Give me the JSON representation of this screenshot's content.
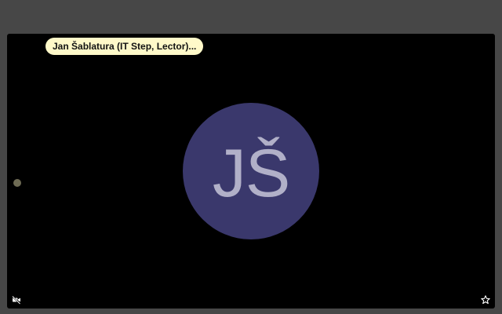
{
  "participant": {
    "display_name": "Jan Šablatura (IT Step, Lector)...",
    "initials": "JŠ"
  },
  "colors": {
    "window_background": "#474747",
    "tile_background": "#000000",
    "name_tag_background": "#fff9c9",
    "avatar_background": "#3a386c",
    "avatar_text": "#b1b0c8",
    "speaking_indicator": "#6e6b54"
  },
  "icons": {
    "bottom_left": "video-camera-off-icon",
    "bottom_right": "star-icon"
  }
}
